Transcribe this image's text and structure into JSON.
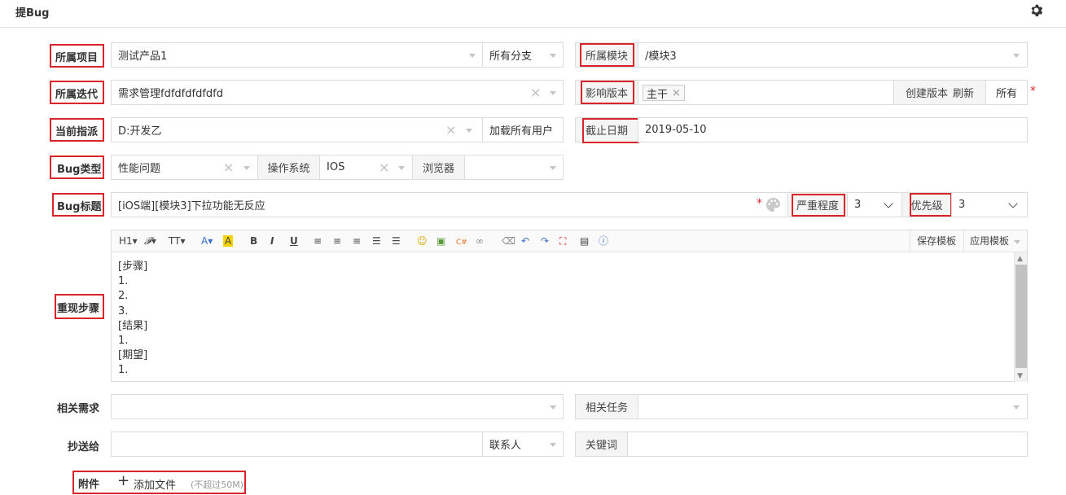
{
  "header": {
    "title": "提Bug"
  },
  "labels": {
    "project": "所属项目",
    "iteration": "所属迭代",
    "assignee": "当前指派",
    "bug_type": "Bug类型",
    "bug_title": "Bug标题",
    "steps": "重现步骤",
    "related_story": "相关需求",
    "cc": "抄送给",
    "attachment": "附件"
  },
  "fields": {
    "project_value": "测试产品1",
    "branch_value": "所有分支",
    "module_label": "所属模块",
    "module_value": "/模块3",
    "iteration_value": "需求管理fdfdfdfdfdfd",
    "affected_version_label": "影响版本",
    "version_tag": "主干",
    "create_version": "创建版本",
    "refresh": "刷新",
    "all": "所有",
    "assignee_value": "D:开发乙",
    "load_all_users": "加载所有用户",
    "deadline_label": "截止日期",
    "deadline_value": "2019-05-10",
    "bug_type_value": "性能问题",
    "os_label": "操作系统",
    "os_value": "IOS",
    "browser_label": "浏览器",
    "title_value": "[iOS端][模块3]下拉功能无反应",
    "severity_label": "严重程度",
    "severity_value": "3",
    "priority_label": "优先级",
    "priority_value": "3",
    "related_task_label": "相关任务",
    "contacts": "联系人",
    "keywords_label": "关键词"
  },
  "editor": {
    "save_template": "保存模板",
    "apply_template": "应用模板",
    "content_lines": [
      "[步骤]",
      "1.",
      "2.",
      "3.",
      "[结果]",
      "1.",
      "[期望]",
      "1."
    ]
  },
  "attachment": {
    "add_file": "添加文件",
    "limit": "(不超过50M)"
  },
  "colors": {
    "highlight_border": "#d9242a",
    "required_star": "#d9242a"
  }
}
